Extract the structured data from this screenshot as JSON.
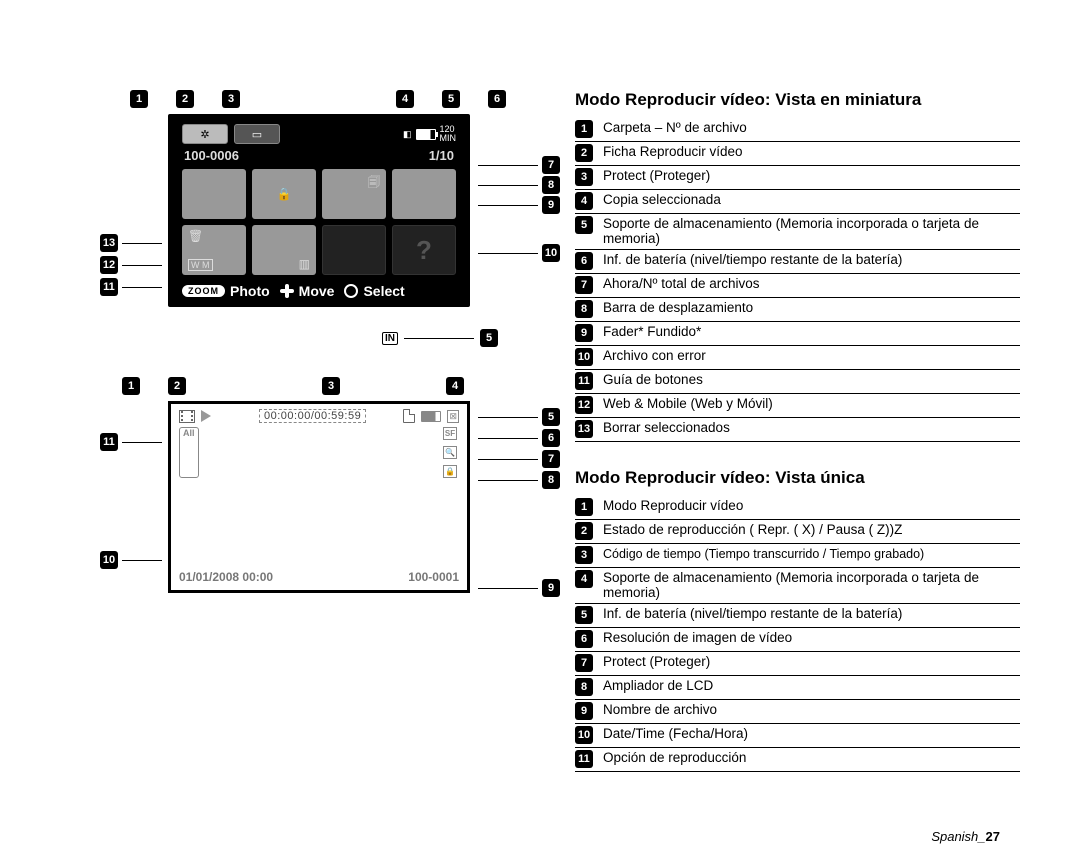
{
  "section1": {
    "title": "Modo Reproducir vídeo: Vista en miniatura",
    "items": [
      "Carpeta – Nº de archivo",
      "Ficha Reproducir vídeo",
      "Protect (Proteger)",
      "Copia seleccionada",
      "Soporte de almacenamiento (Memoria incorporada o tarjeta de memoria)",
      "Inf. de batería (nivel/tiempo restante de la batería)",
      "Ahora/Nº total de archivos",
      "Barra de desplazamiento",
      "Fader* Fundido*",
      "Archivo con error",
      "Guía de botones",
      "Web & Mobile (Web y Móvil)",
      "Borrar seleccionados"
    ]
  },
  "section2": {
    "title": "Modo Reproducir vídeo: Vista única",
    "items": [
      "Modo Reproducir vídeo",
      "Estado de reproducción ( Repr. (  X) / Pausa (  Z))Z",
      "Código de tiempo (Tiempo transcurrido / Tiempo grabado)",
      "Soporte de almacenamiento (Memoria incorporada o tarjeta de memoria)",
      "Inf. de batería (nivel/tiempo restante de la batería)",
      "Resolución de imagen de vídeo",
      "Protect (Proteger)",
      "Ampliador de LCD",
      "Nombre de archivo",
      "Date/Time (Fecha/Hora)",
      "Opción de reproducción"
    ]
  },
  "screen1": {
    "folder_no": "100-0006",
    "page": "1/10",
    "batt_time": "120",
    "batt_unit": "MIN",
    "zoom_label": "ZOOM",
    "btn_photo": "Photo",
    "btn_move": "Move",
    "btn_select": "Select",
    "in_label": "IN"
  },
  "screen2": {
    "timecode": "00:00:00/00:59:59",
    "all_label": "All",
    "datetime": "01/01/2008  00:00",
    "filename": "100-0001"
  },
  "footer": {
    "lang": "Spanish",
    "sep": "_",
    "page": "27"
  },
  "nums": {
    "1": "1",
    "2": "2",
    "3": "3",
    "4": "4",
    "5": "5",
    "6": "6",
    "7": "7",
    "8": "8",
    "9": "9",
    "10": "10",
    "11": "11",
    "12": "12",
    "13": "13"
  }
}
